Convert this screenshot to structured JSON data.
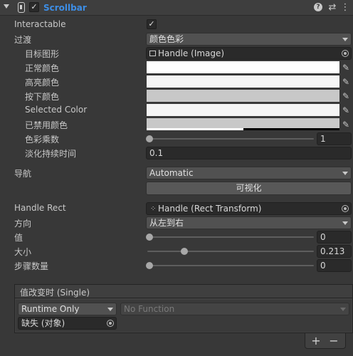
{
  "header": {
    "title": "Scrollbar",
    "enabled": true,
    "icons": [
      "foldout-arrow-icon",
      "script-icon",
      "help-icon",
      "preset-icon",
      "context-menu-icon"
    ]
  },
  "fields": {
    "interactable": {
      "label": "Interactable",
      "checked": "✓"
    },
    "transition": {
      "label": "过渡",
      "value": "颜色色彩"
    },
    "target_graphic": {
      "label": "目标图形",
      "value": "Handle (Image)"
    },
    "normal_color": {
      "label": "正常颜色",
      "color": "#ffffff"
    },
    "highlighted_color": {
      "label": "高亮颜色",
      "color": "#f5f5f5"
    },
    "pressed_color": {
      "label": "按下颜色",
      "color": "#c8c8c8"
    },
    "selected_color": {
      "label": "Selected Color",
      "color": "#f5f5f5"
    },
    "disabled_color": {
      "label": "已禁用颜色",
      "color": "#c8c8c8",
      "alpha": 0.5
    },
    "color_multiplier": {
      "label": "色彩乘数",
      "value": "1",
      "fraction": 0.0
    },
    "fade_duration": {
      "label": "淡化持续时间",
      "value": "0.1"
    },
    "navigation": {
      "label": "导航",
      "value": "Automatic"
    },
    "visualize_button": "可视化",
    "handle_rect": {
      "label": "Handle Rect",
      "value": "Handle (Rect Transform)"
    },
    "direction": {
      "label": "方向",
      "value": "从左到右"
    },
    "value": {
      "label": "值",
      "value": "0",
      "fraction": 0.0
    },
    "size": {
      "label": "大小",
      "value": "0.213",
      "fraction": 0.213
    },
    "number_of_steps": {
      "label": "步骤数量",
      "value": "0",
      "fraction": 0.0
    }
  },
  "event": {
    "title": "值改变时 (Single)",
    "runtime_mode": "Runtime Only",
    "function": "No Function",
    "target_object": "缺失 (对象)",
    "add_label": "+",
    "remove_label": "−"
  },
  "colors": {
    "accent": "#3d8ee6",
    "background": "#383838",
    "field": "#2a2a2a",
    "dropdown": "#515151"
  }
}
